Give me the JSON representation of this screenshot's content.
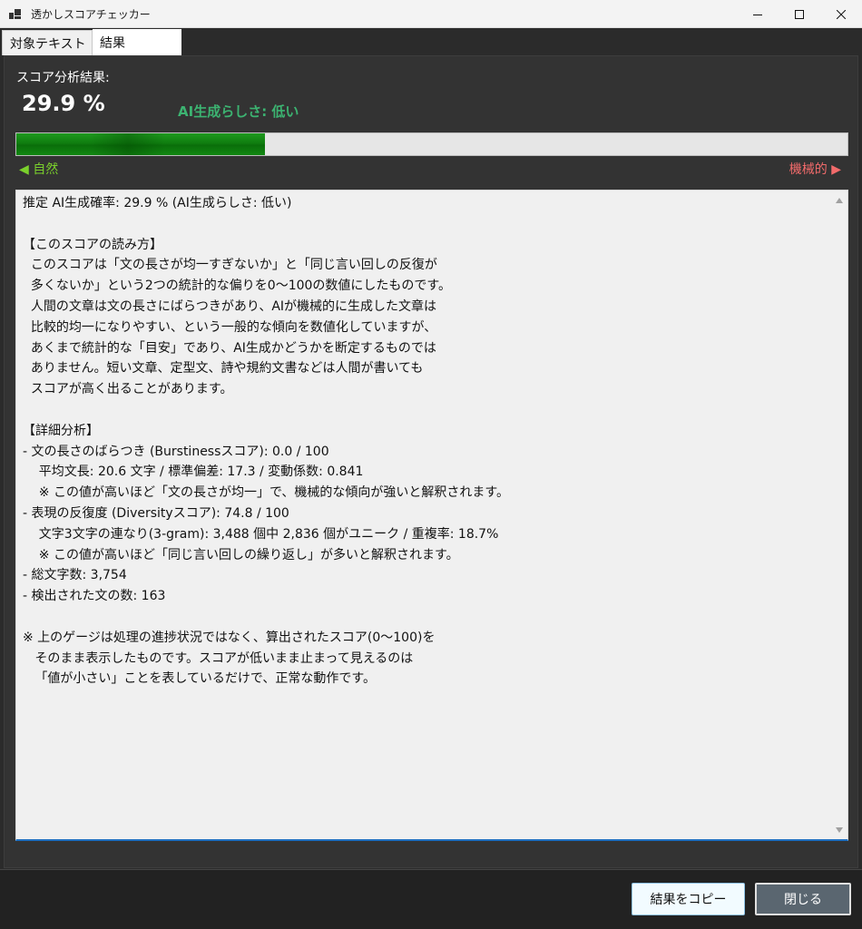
{
  "window": {
    "title": "透かしスコアチェッカー"
  },
  "tabs": [
    {
      "label": "対象テキスト"
    },
    {
      "label": "結果"
    }
  ],
  "results": {
    "score_label": "スコア分析結果:",
    "score_value": "29.9 %",
    "ai_level": "AI生成らしさ: 低い",
    "gauge_percent": 29.9,
    "scale_left": "◀ 自然",
    "scale_right": "機械的 ▶",
    "colors": {
      "ai_level": "#3cb371",
      "gauge_fill": "#128812",
      "scale_left": "#7bd12c",
      "scale_right": "#f26b6b"
    },
    "details_text": "推定 AI生成確率: 29.9 % (AI生成らしさ: 低い)\n\n【このスコアの読み方】\n  このスコアは「文の長さが均一すぎないか」と「同じ言い回しの反復が\n  多くないか」という2つの統計的な偏りを0〜100の数値にしたものです。\n  人間の文章は文の長さにばらつきがあり、AIが機械的に生成した文章は\n  比較的均一になりやすい、という一般的な傾向を数値化していますが、\n  あくまで統計的な「目安」であり、AI生成かどうかを断定するものでは\n  ありません。短い文章、定型文、詩や規約文書などは人間が書いても\n  スコアが高く出ることがあります。\n\n【詳細分析】\n- 文の長さのばらつき (Burstinessスコア): 0.0 / 100\n    平均文長: 20.6 文字 / 標準偏差: 17.3 / 変動係数: 0.841\n    ※ この値が高いほど「文の長さが均一」で、機械的な傾向が強いと解釈されます。\n- 表現の反復度 (Diversityスコア): 74.8 / 100\n    文字3文字の連なり(3-gram): 3,488 個中 2,836 個がユニーク / 重複率: 18.7%\n    ※ この値が高いほど「同じ言い回しの繰り返し」が多いと解釈されます。\n- 総文字数: 3,754\n- 検出された文の数: 163\n\n※ 上のゲージは処理の進捗状況ではなく、算出されたスコア(0〜100)を\n   そのまま表示したものです。スコアが低いまま止まって見えるのは\n   「値が小さい」ことを表しているだけで、正常な動作です。"
  },
  "footer": {
    "copy_label": "結果をコピー",
    "close_label": "閉じる"
  }
}
